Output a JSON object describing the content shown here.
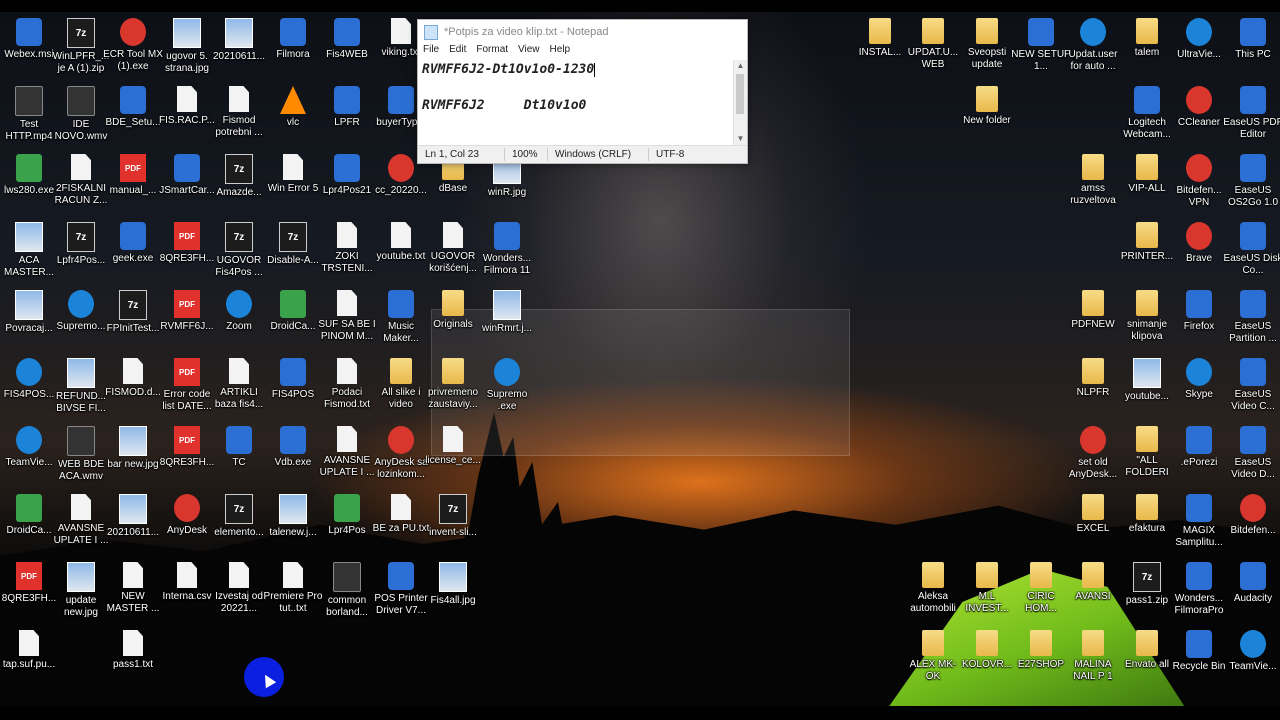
{
  "notepad": {
    "title": "*Potpis za video klip.txt - Notepad",
    "menu": [
      "File",
      "Edit",
      "Format",
      "View",
      "Help"
    ],
    "line1": "RVMFF6J2-Dt1Ov1o0-1230",
    "line2": "RVMFF6J2     Dt10v1o0",
    "status": {
      "position": "Ln 1, Col 23",
      "zoom": "100%",
      "eol": "Windows (CRLF)",
      "encoding": "UTF-8"
    }
  },
  "desktop_left": [
    {
      "label": "Webex.msi",
      "icon": "installer-icon"
    },
    {
      "label": "WinLPFR_... je A (1).zip",
      "icon": "7zip-icon"
    },
    {
      "label": "ECR Tool MX (1).exe",
      "icon": "dx-app-icon"
    },
    {
      "label": "ugovor 5. strana.jpg",
      "icon": "image-file-icon"
    },
    {
      "label": "20210611...",
      "icon": "photo-icon"
    },
    {
      "label": "Filmora",
      "icon": "filmora-icon"
    },
    {
      "label": "Fis4WEB",
      "icon": "fis4web-icon"
    },
    {
      "label": "viking.txt",
      "icon": "text-file-icon"
    },
    {
      "label": "Test HTTP.mp4",
      "icon": "video-file-icon"
    },
    {
      "label": "IDE NOVO.wmv",
      "icon": "video-file-icon"
    },
    {
      "label": "BDE_Setu...",
      "icon": "setup-icon"
    },
    {
      "label": "FIS.RAC.P...",
      "icon": "file-icon"
    },
    {
      "label": "Fismod potrebni ...",
      "icon": "word-doc-icon"
    },
    {
      "label": "vlc",
      "icon": "vlc-icon"
    },
    {
      "label": "LPFR",
      "icon": "lpfr-icon"
    },
    {
      "label": "buyerTyp...",
      "icon": "app-icon"
    },
    {
      "label": "lws280.exe",
      "icon": "logitech-icon"
    },
    {
      "label": "2FISKALNI RACUN Z...",
      "icon": "document-icon"
    },
    {
      "label": "manual_...",
      "icon": "pdf-icon"
    },
    {
      "label": "JSmartCar...",
      "icon": "java-icon"
    },
    {
      "label": "Amazde...",
      "icon": "7zip-icon"
    },
    {
      "label": "Win Error 5",
      "icon": "notepad-icon"
    },
    {
      "label": "Lpr4Pos21",
      "icon": "lpfr-icon"
    },
    {
      "label": "cc_20220...",
      "icon": "ccleaner-icon"
    },
    {
      "label": "dBase",
      "icon": "folder-icon"
    },
    {
      "label": "winR.jpg",
      "icon": "image-file-icon"
    },
    {
      "label": "ACA MASTER...",
      "icon": "image-file-icon"
    },
    {
      "label": "Lpfr4Pos...",
      "icon": "7zip-icon"
    },
    {
      "label": "geek.exe",
      "icon": "geek-icon"
    },
    {
      "label": "8QRE3FH...",
      "icon": "pdf-icon"
    },
    {
      "label": "UGOVOR Fis4Pos ...",
      "icon": "7zip-icon"
    },
    {
      "label": "Disable-A...",
      "icon": "7zip-icon"
    },
    {
      "label": "ZOKI TRSTENI...",
      "icon": "text-file-icon"
    },
    {
      "label": "youtube.txt",
      "icon": "text-file-icon"
    },
    {
      "label": "UGOVOR korišćenj...",
      "icon": "word-doc-icon"
    },
    {
      "label": "Wonders... Filmora 11",
      "icon": "filmora-icon"
    },
    {
      "label": "Povracaj...",
      "icon": "image-file-icon"
    },
    {
      "label": "Supremo...",
      "icon": "supremo-icon"
    },
    {
      "label": "FPInitTest...",
      "icon": "7zip-icon"
    },
    {
      "label": "RVMFF6J...",
      "icon": "pdf-icon"
    },
    {
      "label": "Zoom",
      "icon": "zoom-icon"
    },
    {
      "label": "DroidCa...",
      "icon": "droidcam-icon"
    },
    {
      "label": "SUF SA BE I PINOM M...",
      "icon": "text-file-icon"
    },
    {
      "label": "Music Maker...",
      "icon": "music-maker-icon"
    },
    {
      "label": "Originals",
      "icon": "folder-icon"
    },
    {
      "label": "winRmrt.j...",
      "icon": "image-file-icon"
    },
    {
      "label": "FIS4POS...",
      "icon": "help-icon"
    },
    {
      "label": "REFUND... BIVSE FI...",
      "icon": "image-file-icon"
    },
    {
      "label": "FISMOD.d...",
      "icon": "word-doc-icon"
    },
    {
      "label": "Error code list DATE...",
      "icon": "pdf-icon"
    },
    {
      "label": "ARTIKLI baza fis4...",
      "icon": "text-a-icon"
    },
    {
      "label": "FIS4POS",
      "icon": "fis4web-icon"
    },
    {
      "label": "Podaci Fismod.txt",
      "icon": "text-file-icon"
    },
    {
      "label": "All slike i video",
      "icon": "folder-icon"
    },
    {
      "label": "privremeno zaustaviy...",
      "icon": "folder-icon"
    },
    {
      "label": "Supremo .exe",
      "icon": "supremo-icon"
    },
    {
      "label": "TeamVie...",
      "icon": "teamviewer-icon"
    },
    {
      "label": "WEB BDE ACA.wmv",
      "icon": "video-file-icon"
    },
    {
      "label": "bar new.jpg",
      "icon": "image-file-icon"
    },
    {
      "label": "8QRE3FH...",
      "icon": "pdf-icon"
    },
    {
      "label": "TC",
      "icon": "floppy-icon"
    },
    {
      "label": "Vdb.exe",
      "icon": "vdb-icon"
    },
    {
      "label": "AVANSNE UPLATE I ...",
      "icon": "document-icon"
    },
    {
      "label": "AnyDesk sa lozinkom...",
      "icon": "anydesk-video-icon"
    },
    {
      "label": "license_ce...",
      "icon": "text-file-icon"
    },
    {
      "label": "DroidCa...",
      "icon": "droidcam-icon"
    },
    {
      "label": "AVANSNE UPLATE I ...",
      "icon": "document-icon"
    },
    {
      "label": "20210611...",
      "icon": "photo-icon"
    },
    {
      "label": "AnyDesk",
      "icon": "anydesk-icon"
    },
    {
      "label": "elemento...",
      "icon": "7zip-icon"
    },
    {
      "label": "talenew.j...",
      "icon": "photo-icon"
    },
    {
      "label": "Lpr4Pos",
      "icon": "lpr4pos-icon"
    },
    {
      "label": "BE za PU.txt",
      "icon": "text-file-icon"
    },
    {
      "label": "invent-sli...",
      "icon": "7zip-icon"
    },
    {
      "label": "8QRE3FH...",
      "icon": "pdf-icon"
    },
    {
      "label": "update new.jpg",
      "icon": "image-file-icon"
    },
    {
      "label": "NEW MASTER ...",
      "icon": "word-doc-icon"
    },
    {
      "label": "Interna.csv",
      "icon": "text-a-icon"
    },
    {
      "label": "Izvestaj od 20221...",
      "icon": "text-a-icon"
    },
    {
      "label": "Premiere Pro tut..txt",
      "icon": "text-file-icon"
    },
    {
      "label": "common borland...",
      "icon": "dark-file-icon"
    },
    {
      "label": "POS Printer Driver V7...",
      "icon": "printer-driver-icon"
    },
    {
      "label": "Fis4all.jpg",
      "icon": "image-file-icon"
    },
    {
      "label": "tap.suf.pu...",
      "icon": "text-file-icon"
    },
    {
      "label": "pass1.txt",
      "icon": "text-file-icon"
    }
  ],
  "desktop_right": [
    {
      "label": "INSTAL...",
      "icon": "folder-doc-icon"
    },
    {
      "label": "UPDAT.U... WEB",
      "icon": "folder-doc-icon"
    },
    {
      "label": "Sveopsti update",
      "icon": "folder-doc-icon"
    },
    {
      "label": "NEW SETUP 1...",
      "icon": "winrar-icon"
    },
    {
      "label": "Updat.user for auto ...",
      "icon": "info-icon"
    },
    {
      "label": "talem",
      "icon": "folder-icon"
    },
    {
      "label": "UltraVie...",
      "icon": "ultraviewer-icon"
    },
    {
      "label": "This PC",
      "icon": "computer-icon"
    },
    {
      "label": "New folder",
      "icon": "gear-folder-icon"
    },
    {
      "label": "Logitech Webcam...",
      "icon": "webcam-icon"
    },
    {
      "label": "CCleaner",
      "icon": "ccleaner-icon"
    },
    {
      "label": "EaseUS PDF Editor",
      "icon": "easeus-icon"
    },
    {
      "label": "amss ruzveltova",
      "icon": "folder-icon"
    },
    {
      "label": "VIP-ALL",
      "icon": "folder-icon"
    },
    {
      "label": "Bitdefen... VPN",
      "icon": "bitdefender-vpn-icon"
    },
    {
      "label": "EaseUS OS2Go 1.0",
      "icon": "easeus-icon"
    },
    {
      "label": "PRINTER...",
      "icon": "folder-icon"
    },
    {
      "label": "Brave",
      "icon": "brave-icon"
    },
    {
      "label": "EaseUS Disk Co...",
      "icon": "easeus-icon"
    },
    {
      "label": "PDFNEW",
      "icon": "folder-doc-icon"
    },
    {
      "label": "snimanje klipova",
      "icon": "folder-doc-icon"
    },
    {
      "label": "Firefox",
      "icon": "firefox-icon"
    },
    {
      "label": "EaseUS Partition ...",
      "icon": "easeus-icon"
    },
    {
      "label": "NLPFR",
      "icon": "folder-doc-icon"
    },
    {
      "label": "youtube...",
      "icon": "image-file-icon"
    },
    {
      "label": "Skype",
      "icon": "skype-icon"
    },
    {
      "label": "EaseUS Video C...",
      "icon": "easeus-icon"
    },
    {
      "label": "set old AnyDesk...",
      "icon": "anydesk-icon"
    },
    {
      "label": "\"ALL FOLDERI",
      "icon": "folder-icon"
    },
    {
      "label": ".ePorezi",
      "icon": "eporezi-icon"
    },
    {
      "label": "EaseUS Video D...",
      "icon": "easeus-icon"
    },
    {
      "label": "EXCEL",
      "icon": "folder-doc-icon"
    },
    {
      "label": "efaktura",
      "icon": "folder-doc-icon"
    },
    {
      "label": "MAGIX Samplitu...",
      "icon": "magix-icon"
    },
    {
      "label": "Bitdefen...",
      "icon": "bitdefender-icon"
    },
    {
      "label": "Aleksa automobili",
      "icon": "folder-doc-icon"
    },
    {
      "label": "M.L INVEST...",
      "icon": "folder-doc-icon"
    },
    {
      "label": "CIRIC HOM...",
      "icon": "folder-doc-icon"
    },
    {
      "label": "AVANSI",
      "icon": "folder-icon"
    },
    {
      "label": "pass1.zip",
      "icon": "7zip-icon"
    },
    {
      "label": "Wonders... FilmoraPro",
      "icon": "filmora-icon"
    },
    {
      "label": "Audacity",
      "icon": "audacity-icon"
    },
    {
      "label": "ALEX MK-OK",
      "icon": "folder-doc-icon"
    },
    {
      "label": "KOLOVR...",
      "icon": "folder-doc-icon"
    },
    {
      "label": "E27SHOP",
      "icon": "folder-doc-icon"
    },
    {
      "label": "MALINA NAIL P 1",
      "icon": "folder-doc-icon"
    },
    {
      "label": "Envato all",
      "icon": "folder-icon"
    },
    {
      "label": "Recycle Bin",
      "icon": "recycle-bin-icon"
    },
    {
      "label": "TeamVie...",
      "icon": "teamviewer-icon"
    }
  ]
}
